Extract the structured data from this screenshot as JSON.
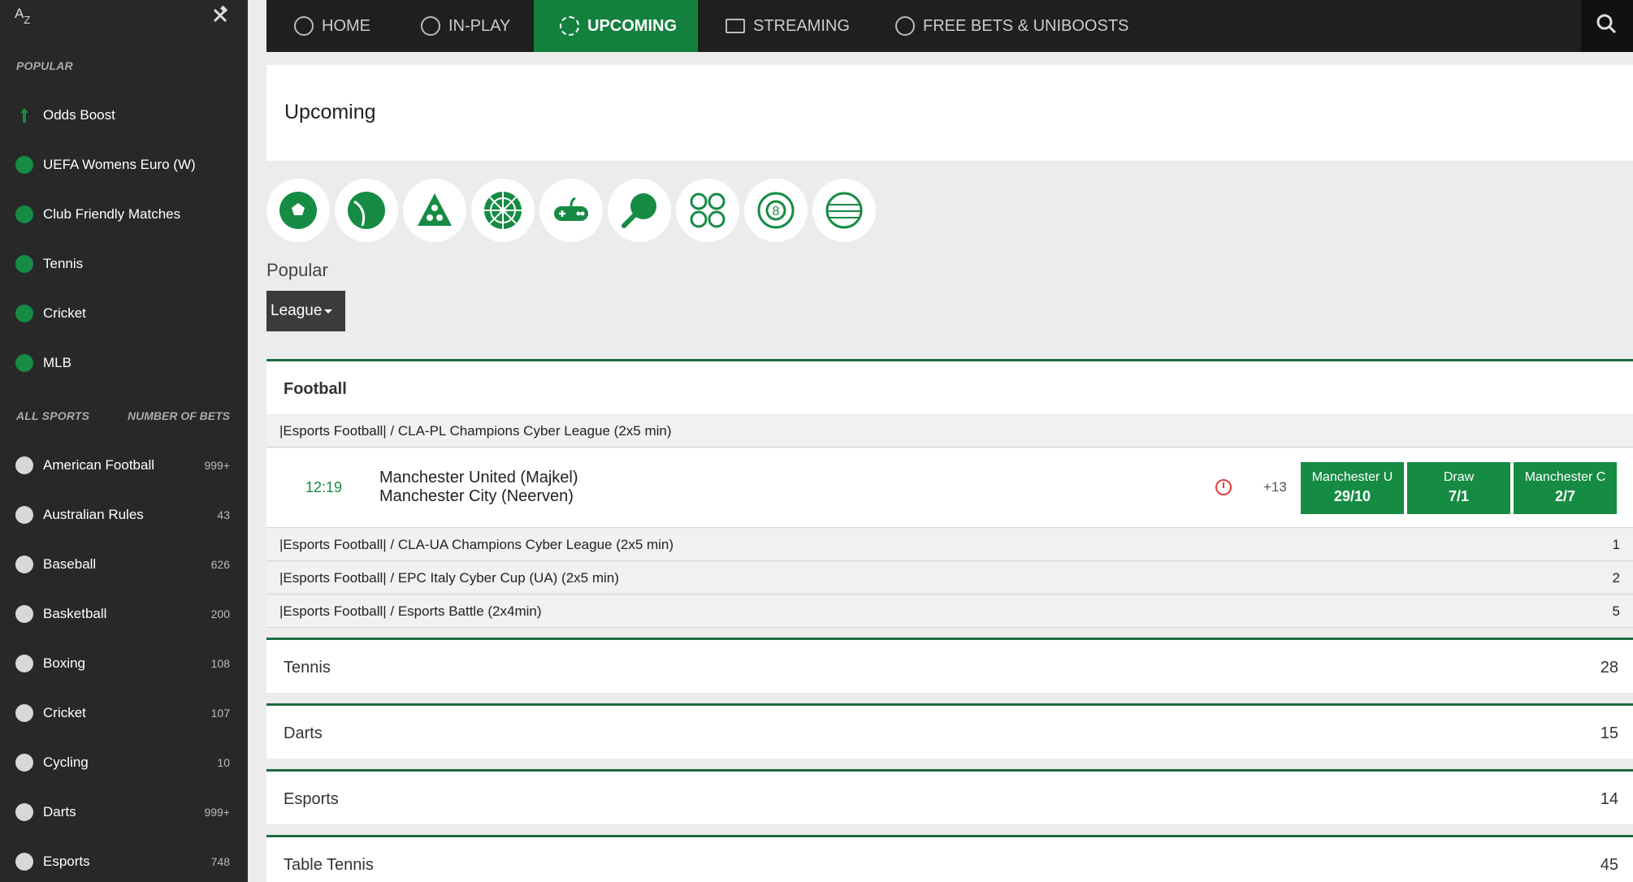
{
  "sidebar": {
    "az_label": "A",
    "az_sub": "Z",
    "popular_heading": "POPULAR",
    "popular_items": [
      {
        "label": "Odds Boost",
        "icon": "odds-boost-icon"
      },
      {
        "label": "UEFA Womens Euro (W)",
        "icon": "football-icon"
      },
      {
        "label": "Club Friendly Matches",
        "icon": "football-icon"
      },
      {
        "label": "Tennis",
        "icon": "tennis-icon"
      },
      {
        "label": "Cricket",
        "icon": "cricket-icon"
      },
      {
        "label": "MLB",
        "icon": "baseball-icon"
      }
    ],
    "all_sports_heading": "ALL SPORTS",
    "number_of_bets_heading": "NUMBER OF BETS",
    "sports": [
      {
        "label": "American Football",
        "count": "999+",
        "icon": "american-football-icon"
      },
      {
        "label": "Australian Rules",
        "count": "43",
        "icon": "australian-rules-icon"
      },
      {
        "label": "Baseball",
        "count": "626",
        "icon": "baseball-icon"
      },
      {
        "label": "Basketball",
        "count": "200",
        "icon": "basketball-icon"
      },
      {
        "label": "Boxing",
        "count": "108",
        "icon": "boxing-icon"
      },
      {
        "label": "Cricket",
        "count": "107",
        "icon": "cricket-icon"
      },
      {
        "label": "Cycling",
        "count": "10",
        "icon": "cycling-icon"
      },
      {
        "label": "Darts",
        "count": "999+",
        "icon": "darts-icon"
      },
      {
        "label": "Esports",
        "count": "748",
        "icon": "esports-icon"
      }
    ]
  },
  "topnav": {
    "items": [
      {
        "label": "HOME",
        "icon": "home-icon"
      },
      {
        "label": "IN-PLAY",
        "icon": "in-play-icon"
      },
      {
        "label": "UPCOMING",
        "icon": "upcoming-icon",
        "active": true
      },
      {
        "label": "STREAMING",
        "icon": "streaming-icon"
      },
      {
        "label": "FREE BETS & UNIBOOSTS",
        "icon": "free-bets-icon"
      }
    ]
  },
  "main": {
    "title": "Upcoming",
    "sport_filter_icons": [
      "football-icon",
      "tennis-icon",
      "snooker-icon",
      "darts-icon",
      "esports-icon",
      "table-tennis-icon",
      "virtual-sports-icon",
      "pool-icon",
      "volleyball-icon"
    ],
    "popular_label": "Popular",
    "league_dropdown": "League",
    "football": {
      "name": "Football",
      "leagues": [
        {
          "name": "|Esports Football| / CLA-PL Champions Cyber League (2x5 min)",
          "count": ""
        },
        {
          "name": "|Esports Football| / CLA-UA Champions Cyber League (2x5 min)",
          "count": "1"
        },
        {
          "name": "|Esports Football| / EPC Italy Cyber Cup (UA) (2x5 min)",
          "count": "2"
        },
        {
          "name": "|Esports Football| / Esports Battle (2x4min)",
          "count": "5"
        }
      ],
      "event": {
        "time": "12:19",
        "home": "Manchester United (Majkel)",
        "away": "Manchester City (Neerven)",
        "more_markets": "+13",
        "odds": [
          {
            "label": "Manchester U",
            "value": "29/10"
          },
          {
            "label": "Draw",
            "value": "7/1"
          },
          {
            "label": "Manchester C",
            "value": "2/7"
          }
        ]
      }
    },
    "other_sports": [
      {
        "name": "Tennis",
        "count": "28"
      },
      {
        "name": "Darts",
        "count": "15"
      },
      {
        "name": "Esports",
        "count": "14"
      },
      {
        "name": "Table Tennis",
        "count": "45"
      }
    ]
  },
  "colors": {
    "accent": "#168b44",
    "sidebar_bg": "#282828",
    "nav_bg": "#1f1f1f",
    "page_bg": "#ececec",
    "alert": "#e03b3b"
  }
}
